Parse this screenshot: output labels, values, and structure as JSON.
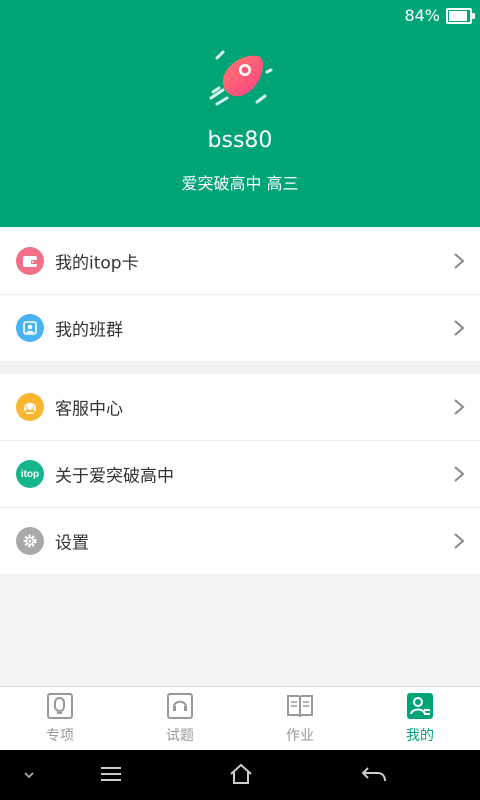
{
  "status_bar": {
    "battery_percent_text": "84%",
    "battery_level": 0.84
  },
  "profile": {
    "username": "bss80",
    "school": "爱突破高中 高三"
  },
  "menu_group_1": [
    {
      "label": "我的itop卡",
      "icon": "wallet-icon",
      "color": "#f36f87"
    },
    {
      "label": "我的班群",
      "icon": "class-group-icon",
      "color": "#48b4f5"
    }
  ],
  "menu_group_2": [
    {
      "label": "客服中心",
      "icon": "customer-service-icon",
      "color": "#fbb62f"
    },
    {
      "label": "关于爱突破高中",
      "icon": "itop-logo-icon",
      "color": "#14b58a"
    },
    {
      "label": "设置",
      "icon": "gear-icon",
      "color": "#a9a9a9"
    }
  ],
  "itop_logo_text": "itop",
  "tabs": [
    {
      "label": "专项",
      "icon": "special-topic-icon"
    },
    {
      "label": "试题",
      "icon": "exam-icon"
    },
    {
      "label": "作业",
      "icon": "homework-book-icon"
    },
    {
      "label": "我的",
      "icon": "profile-icon",
      "active": true
    }
  ],
  "colors": {
    "brand": "#00a476",
    "inactive": "#999999"
  }
}
